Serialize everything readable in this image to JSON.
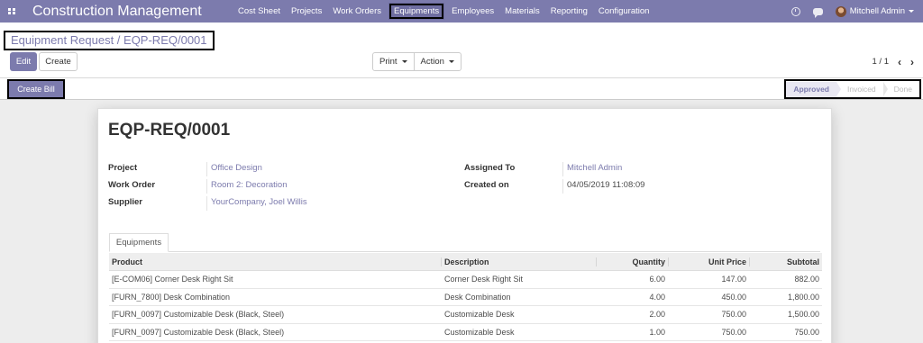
{
  "app": {
    "brand": "Construction Management",
    "menu": [
      "Cost Sheet",
      "Projects",
      "Work Orders",
      "Equipments",
      "Employees",
      "Materials",
      "Reporting",
      "Configuration"
    ],
    "active_menu": "Equipments",
    "user_name": "Mitchell Admin"
  },
  "breadcrumb": "Equipment Request / EQP-REQ/0001",
  "buttons": {
    "edit": "Edit",
    "create": "Create",
    "print": "Print",
    "action": "Action",
    "create_bill": "Create Bill"
  },
  "pager": "1 / 1",
  "status": {
    "stages": [
      "Approved",
      "Invoiced",
      "Done"
    ],
    "current": "Approved"
  },
  "record": {
    "title": "EQP-REQ/0001",
    "fields_left": [
      {
        "label": "Project",
        "value": "Office Design",
        "link": true
      },
      {
        "label": "Work Order",
        "value": "Room 2: Decoration",
        "link": true
      },
      {
        "label": "Supplier",
        "value": "YourCompany, Joel Willis",
        "link": true
      }
    ],
    "fields_right": [
      {
        "label": "Assigned To",
        "value": "Mitchell Admin",
        "link": true
      },
      {
        "label": "Created on",
        "value": "04/05/2019 11:08:09",
        "link": false
      }
    ]
  },
  "tab": "Equipments",
  "table": {
    "columns": [
      "Product",
      "Description",
      "Quantity",
      "Unit Price",
      "Subtotal"
    ],
    "rows": [
      [
        "[E-COM06] Corner Desk Right Sit",
        "Corner Desk Right Sit",
        "6.00",
        "147.00",
        "882.00"
      ],
      [
        "[FURN_7800] Desk Combination",
        "Desk Combination",
        "4.00",
        "450.00",
        "1,800.00"
      ],
      [
        "[FURN_0097] Customizable Desk (Black, Steel)",
        "Customizable Desk",
        "2.00",
        "750.00",
        "1,500.00"
      ],
      [
        "[FURN_0097] Customizable Desk (Black, Steel)",
        "Customizable Desk",
        "1.00",
        "750.00",
        "750.00"
      ]
    ]
  },
  "colors": {
    "primary": "#7c7bad",
    "navbar": "#7c7bad"
  }
}
